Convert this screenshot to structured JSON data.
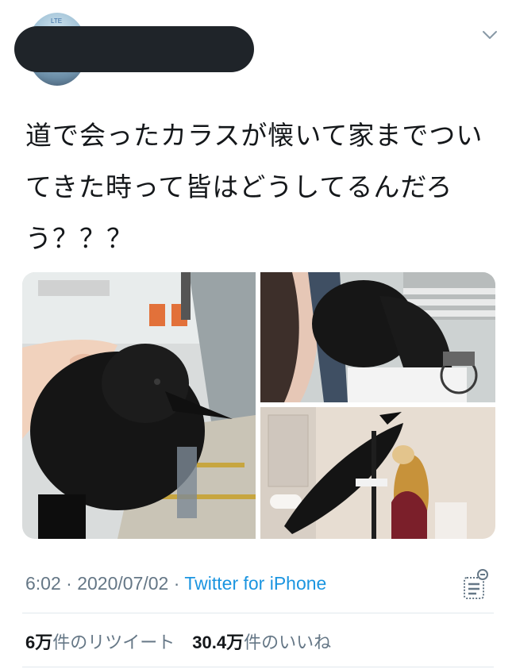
{
  "tweet": {
    "text": "道で会ったカラスが懐いて家までついてきた時って皆はどうしてるんだろう？？？",
    "time": "6:02",
    "date": "2020/07/02",
    "source": "Twitter for iPhone"
  },
  "avatar": {
    "corner_text": "LTE"
  },
  "stats": {
    "retweets_count": "6万",
    "retweets_label": "件のリツイート",
    "likes_count": "30.4万",
    "likes_label": "件のいいね"
  },
  "icons": {
    "more": "chevron-down-icon",
    "analytics": "analytics-icon"
  },
  "colors": {
    "text": "#14171a",
    "muted": "#657786",
    "link": "#1b95e0",
    "divider": "#e1e8ed"
  }
}
